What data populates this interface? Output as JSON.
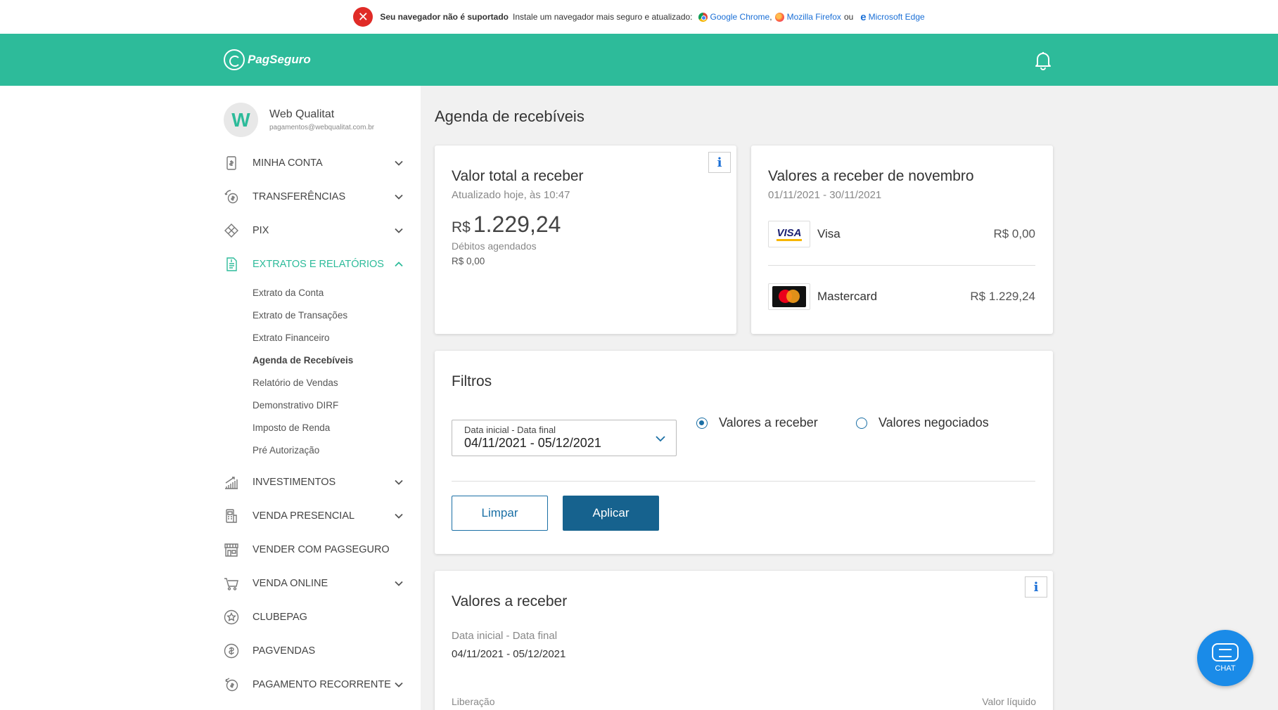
{
  "banner": {
    "bold": "Seu navegador não é suportado",
    "text": "Instale um navegador mais seguro e atualizado:",
    "chrome": "Google Chrome",
    "comma": ",",
    "firefox": "Mozilla Firefox",
    "or": "ou",
    "edge": "Microsoft Edge"
  },
  "header": {
    "logo": "PagSeguro"
  },
  "user": {
    "initial": "W",
    "name": "Web Qualitat",
    "email": "pagamentos@webqualitat.com.br"
  },
  "nav": {
    "minha_conta": "MINHA CONTA",
    "transferencias": "TRANSFERÊNCIAS",
    "pix": "PIX",
    "extratos": "EXTRATOS E RELATÓRIOS",
    "sub": [
      "Extrato da Conta",
      "Extrato de Transações",
      "Extrato Financeiro",
      "Agenda de Recebíveis",
      "Relatório de Vendas",
      "Demonstrativo DIRF",
      "Imposto de Renda",
      "Pré Autorização"
    ],
    "investimentos": "INVESTIMENTOS",
    "venda_presencial": "VENDA PRESENCIAL",
    "vender_com": "VENDER COM PAGSEGURO",
    "venda_online": "VENDA ONLINE",
    "clubepag": "CLUBEPAG",
    "pagvendas": "PAGVENDAS",
    "pagamento_recorrente": "PAGAMENTO RECORRENTE"
  },
  "page": {
    "title": "Agenda de recebíveis"
  },
  "total_card": {
    "info": "i",
    "title": "Valor total a receber",
    "updated": "Atualizado hoje, às 10:47",
    "currency": "R$",
    "amount": "1.229,24",
    "debits_label": "Débitos agendados",
    "debits_value": "R$ 0,00"
  },
  "month_card": {
    "title": "Valores a receber de novembro",
    "period": "01/11/2021 - 30/11/2021",
    "visa_logo": "VISA",
    "visa_name": "Visa",
    "visa_value": "R$ 0,00",
    "mc_name": "Mastercard",
    "mc_value": "R$ 1.229,24"
  },
  "filters": {
    "title": "Filtros",
    "date_label": "Data inicial - Data final",
    "date_value": "04/11/2021 - 05/12/2021",
    "radio_receber": "Valores a receber",
    "radio_negociados": "Valores negociados",
    "clear": "Limpar",
    "apply": "Aplicar"
  },
  "receivables": {
    "info": "i",
    "title": "Valores a receber",
    "date_label": "Data inicial - Data final",
    "date_value": "04/11/2021 - 05/12/2021",
    "col_left": "Liberação",
    "col_right": "Valor líquido"
  },
  "chat": {
    "label": "CHAT"
  }
}
